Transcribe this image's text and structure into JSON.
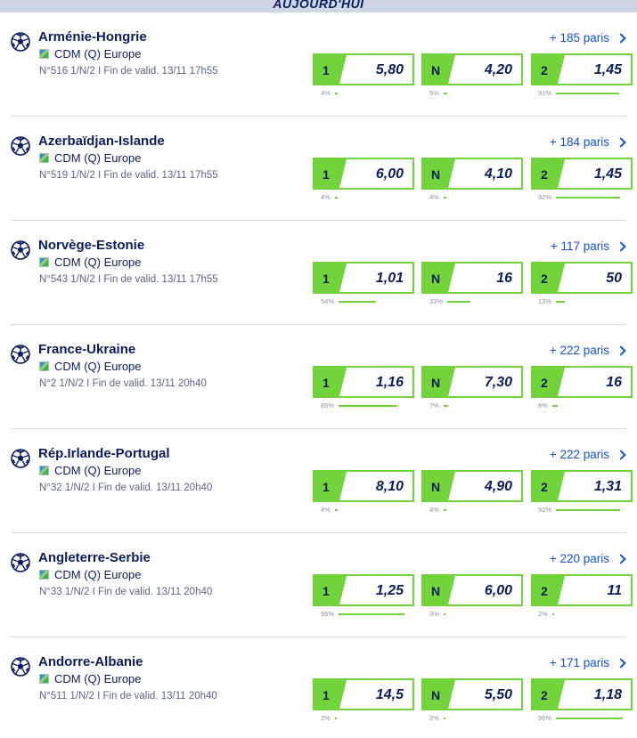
{
  "header": {
    "title": "AUJOURD'HUI"
  },
  "matches": [
    {
      "title": "Arménie-Hongrie",
      "competition": "CDM (Q) Europe",
      "info": "N°516 1/N/2 I Fin de valid. 13/11 17h55",
      "paris": "+ 185 paris",
      "odds": [
        {
          "key": "1",
          "value": "5,80",
          "pct_label": "4%",
          "pct": 4
        },
        {
          "key": "N",
          "value": "4,20",
          "pct_label": "5%",
          "pct": 5
        },
        {
          "key": "2",
          "value": "1,45",
          "pct_label": "91%",
          "pct": 91
        }
      ]
    },
    {
      "title": "Azerbaïdjan-Islande",
      "competition": "CDM (Q) Europe",
      "info": "N°519 1/N/2 I Fin de valid. 13/11 17h55",
      "paris": "+ 184 paris",
      "odds": [
        {
          "key": "1",
          "value": "6,00",
          "pct_label": "4%",
          "pct": 4
        },
        {
          "key": "N",
          "value": "4,10",
          "pct_label": "4%",
          "pct": 4
        },
        {
          "key": "2",
          "value": "1,45",
          "pct_label": "92%",
          "pct": 92
        }
      ]
    },
    {
      "title": "Norvège-Estonie",
      "competition": "CDM (Q) Europe",
      "info": "N°543 1/N/2 I Fin de valid. 13/11 17h55",
      "paris": "+ 117 paris",
      "odds": [
        {
          "key": "1",
          "value": "1,01",
          "pct_label": "54%",
          "pct": 54
        },
        {
          "key": "N",
          "value": "16",
          "pct_label": "33%",
          "pct": 33
        },
        {
          "key": "2",
          "value": "50",
          "pct_label": "13%",
          "pct": 13
        }
      ]
    },
    {
      "title": "France-Ukraine",
      "competition": "CDM (Q) Europe",
      "info": "N°2 1/N/2 I Fin de valid. 13/11 20h40",
      "paris": "+ 222 paris",
      "odds": [
        {
          "key": "1",
          "value": "1,16",
          "pct_label": "85%",
          "pct": 85
        },
        {
          "key": "N",
          "value": "7,30",
          "pct_label": "7%",
          "pct": 7
        },
        {
          "key": "2",
          "value": "16",
          "pct_label": "8%",
          "pct": 8
        }
      ]
    },
    {
      "title": "Rép.Irlande-Portugal",
      "competition": "CDM (Q) Europe",
      "info": "N°32 1/N/2 I Fin de valid. 13/11 20h40",
      "paris": "+ 222 paris",
      "odds": [
        {
          "key": "1",
          "value": "8,10",
          "pct_label": "4%",
          "pct": 4
        },
        {
          "key": "N",
          "value": "4,90",
          "pct_label": "4%",
          "pct": 4
        },
        {
          "key": "2",
          "value": "1,31",
          "pct_label": "92%",
          "pct": 92
        }
      ]
    },
    {
      "title": "Angleterre-Serbie",
      "competition": "CDM (Q) Europe",
      "info": "N°33 1/N/2 I Fin de valid. 13/11 20h40",
      "paris": "+ 220 paris",
      "odds": [
        {
          "key": "1",
          "value": "1,25",
          "pct_label": "95%",
          "pct": 95
        },
        {
          "key": "N",
          "value": "6,00",
          "pct_label": "3%",
          "pct": 3
        },
        {
          "key": "2",
          "value": "11",
          "pct_label": "2%",
          "pct": 2
        }
      ]
    },
    {
      "title": "Andorre-Albanie",
      "competition": "CDM (Q) Europe",
      "info": "N°511 1/N/2 I Fin de valid. 13/11 20h40",
      "paris": "+ 171 paris",
      "odds": [
        {
          "key": "1",
          "value": "14,5",
          "pct_label": "2%",
          "pct": 2
        },
        {
          "key": "N",
          "value": "5,50",
          "pct_label": "2%",
          "pct": 2
        },
        {
          "key": "2",
          "value": "1,18",
          "pct_label": "96%",
          "pct": 96
        }
      ]
    }
  ],
  "colors": {
    "accent": "#72d33a",
    "link": "#1552d6",
    "text": "#0b1e5b"
  }
}
